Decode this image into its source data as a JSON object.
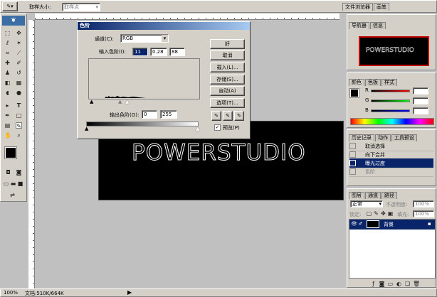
{
  "options_bar": {
    "sample_size_label": "取样大小:",
    "sample_size_value": "取样点"
  },
  "top_tabs": [
    {
      "label": "文件浏览器"
    },
    {
      "label": "画笔"
    }
  ],
  "canvas": {
    "text": "POWERSTUDIO"
  },
  "levels_dialog": {
    "title": "色阶",
    "channel_label": "通道(C):",
    "channel_value": "RGB",
    "input_label": "输入色阶(I):",
    "input_values": [
      "11",
      "0.28",
      "88"
    ],
    "output_label": "输出色阶(O):",
    "output_values": [
      "0",
      "255"
    ],
    "buttons": {
      "ok": "好",
      "cancel": "取消",
      "load": "载入(L)...",
      "save": "存储(S)...",
      "auto": "自动(A)",
      "options": "选项(T)..."
    },
    "preview_label": "预览(P)",
    "preview_checked": true
  },
  "navigator_panel": {
    "tabs": [
      "导航器",
      "信息"
    ],
    "preview_text": "POWERSTUDIO"
  },
  "color_panel": {
    "tabs": [
      "颜色",
      "色板",
      "样式"
    ],
    "channels": [
      "R",
      "G",
      "B"
    ]
  },
  "history_panel": {
    "tabs": [
      "历史记录",
      "动作",
      "工具预设"
    ],
    "items": [
      {
        "label": "取消选择"
      },
      {
        "label": "向下合并"
      },
      {
        "label": "曝光过度",
        "selected": true
      },
      {
        "label": "色阶",
        "disabled": true
      }
    ]
  },
  "layers_panel": {
    "tabs": [
      "图层",
      "通道",
      "路径"
    ],
    "blend_mode": "正常",
    "opacity_label": "不透明度:",
    "opacity_value": "100%",
    "lock_label": "锁定:",
    "fill_label": "填充:",
    "fill_value": "100%",
    "layer_name": "背景"
  },
  "status_bar": {
    "zoom": "100%",
    "doc_info": "文档:510K/664K"
  },
  "colors": {
    "title": "#0a246a",
    "selection": "#0a246a",
    "canvas": "#000000",
    "nav_frame": "#c00000"
  }
}
